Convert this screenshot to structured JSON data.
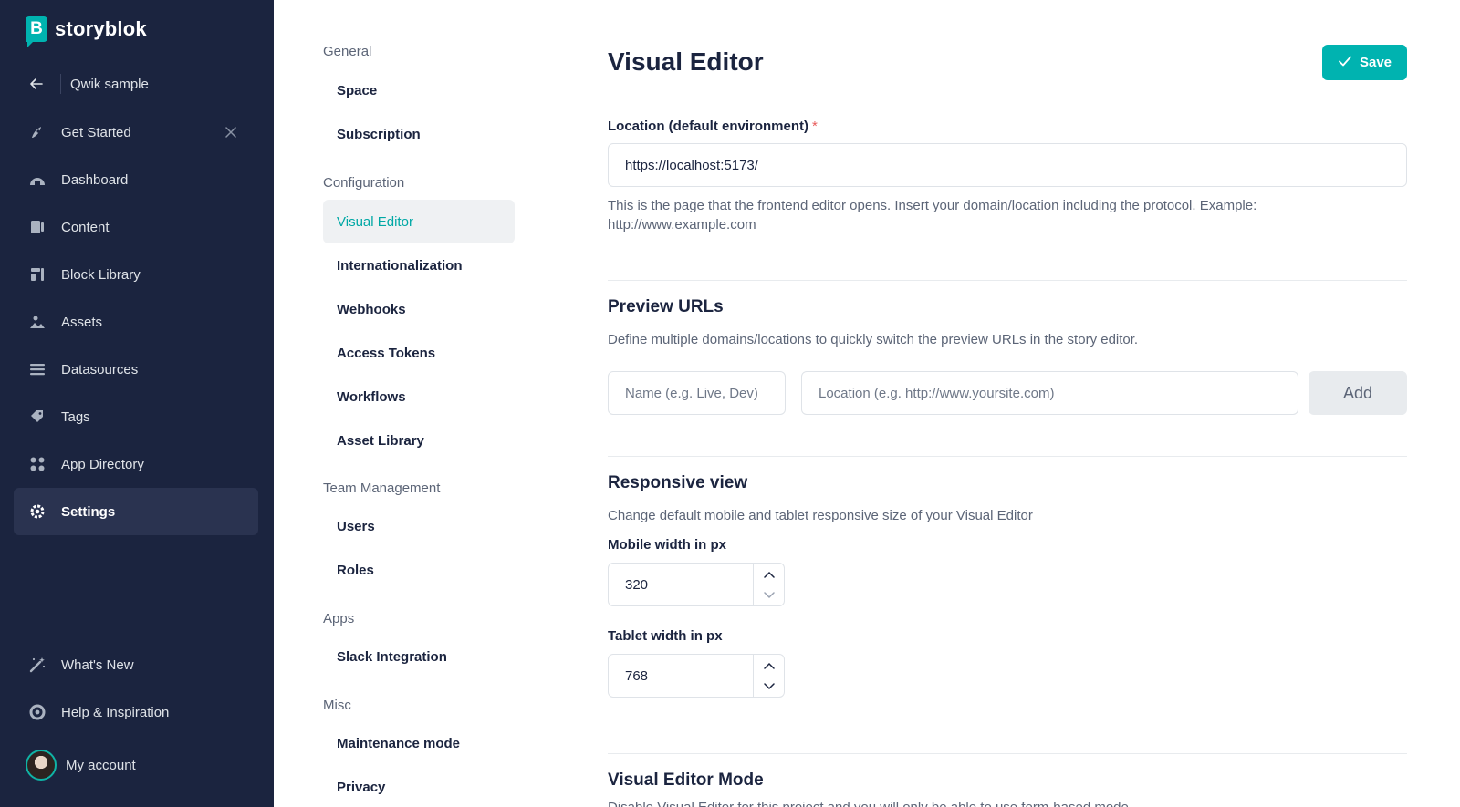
{
  "brand": {
    "name": "storyblok",
    "mark": "B"
  },
  "space": {
    "name": "Qwik sample"
  },
  "sidebar": {
    "items": [
      {
        "label": "Get Started",
        "icon": "rocket-icon"
      },
      {
        "label": "Dashboard",
        "icon": "gauge-icon"
      },
      {
        "label": "Content",
        "icon": "content-icon"
      },
      {
        "label": "Block Library",
        "icon": "blocks-icon"
      },
      {
        "label": "Assets",
        "icon": "image-icon"
      },
      {
        "label": "Datasources",
        "icon": "list-icon"
      },
      {
        "label": "Tags",
        "icon": "tag-icon"
      },
      {
        "label": "App Directory",
        "icon": "apps-icon"
      },
      {
        "label": "Settings",
        "icon": "gear-icon",
        "active": true
      }
    ],
    "bottom": [
      {
        "label": "What's New",
        "icon": "magic-wand-icon"
      },
      {
        "label": "Help & Inspiration",
        "icon": "lifebuoy-icon"
      }
    ],
    "account": "My account"
  },
  "settings_menu": {
    "general": "General",
    "space": "Space",
    "subscription": "Subscription",
    "configuration": "Configuration",
    "visual_editor": "Visual Editor",
    "internationalization": "Internationalization",
    "webhooks": "Webhooks",
    "access_tokens": "Access Tokens",
    "workflows": "Workflows",
    "asset_library": "Asset Library",
    "team_management": "Team Management",
    "users": "Users",
    "roles": "Roles",
    "apps": "Apps",
    "slack_integration": "Slack Integration",
    "misc": "Misc",
    "maintenance_mode": "Maintenance mode",
    "privacy": "Privacy"
  },
  "main": {
    "title": "Visual Editor",
    "save_label": "Save",
    "location": {
      "label": "Location (default environment)",
      "required_mark": "*",
      "value": "https://localhost:5173/",
      "help_line1": "This is the page that the frontend editor opens. Insert your domain/location including the protocol. Example:",
      "help_line2": "http://www.example.com"
    },
    "preview": {
      "title": "Preview URLs",
      "description": "Define multiple domains/locations to quickly switch the preview URLs in the story editor.",
      "name_placeholder": "Name (e.g. Live, Dev)",
      "location_placeholder": "Location (e.g. http://www.yoursite.com)",
      "add_label": "Add"
    },
    "responsive": {
      "title": "Responsive view",
      "description": "Change default mobile and tablet responsive size of your Visual Editor",
      "mobile_label": "Mobile width in px",
      "mobile_value": "320",
      "tablet_label": "Tablet width in px",
      "tablet_value": "768"
    },
    "mode": {
      "title": "Visual Editor Mode",
      "description_cut": "Disable Visual Editor for this project and you will only be able to use form-based mode."
    }
  },
  "colors": {
    "sidebar_bg": "#1b243f",
    "accent": "#00b3b0",
    "required": "#e85b5b"
  }
}
